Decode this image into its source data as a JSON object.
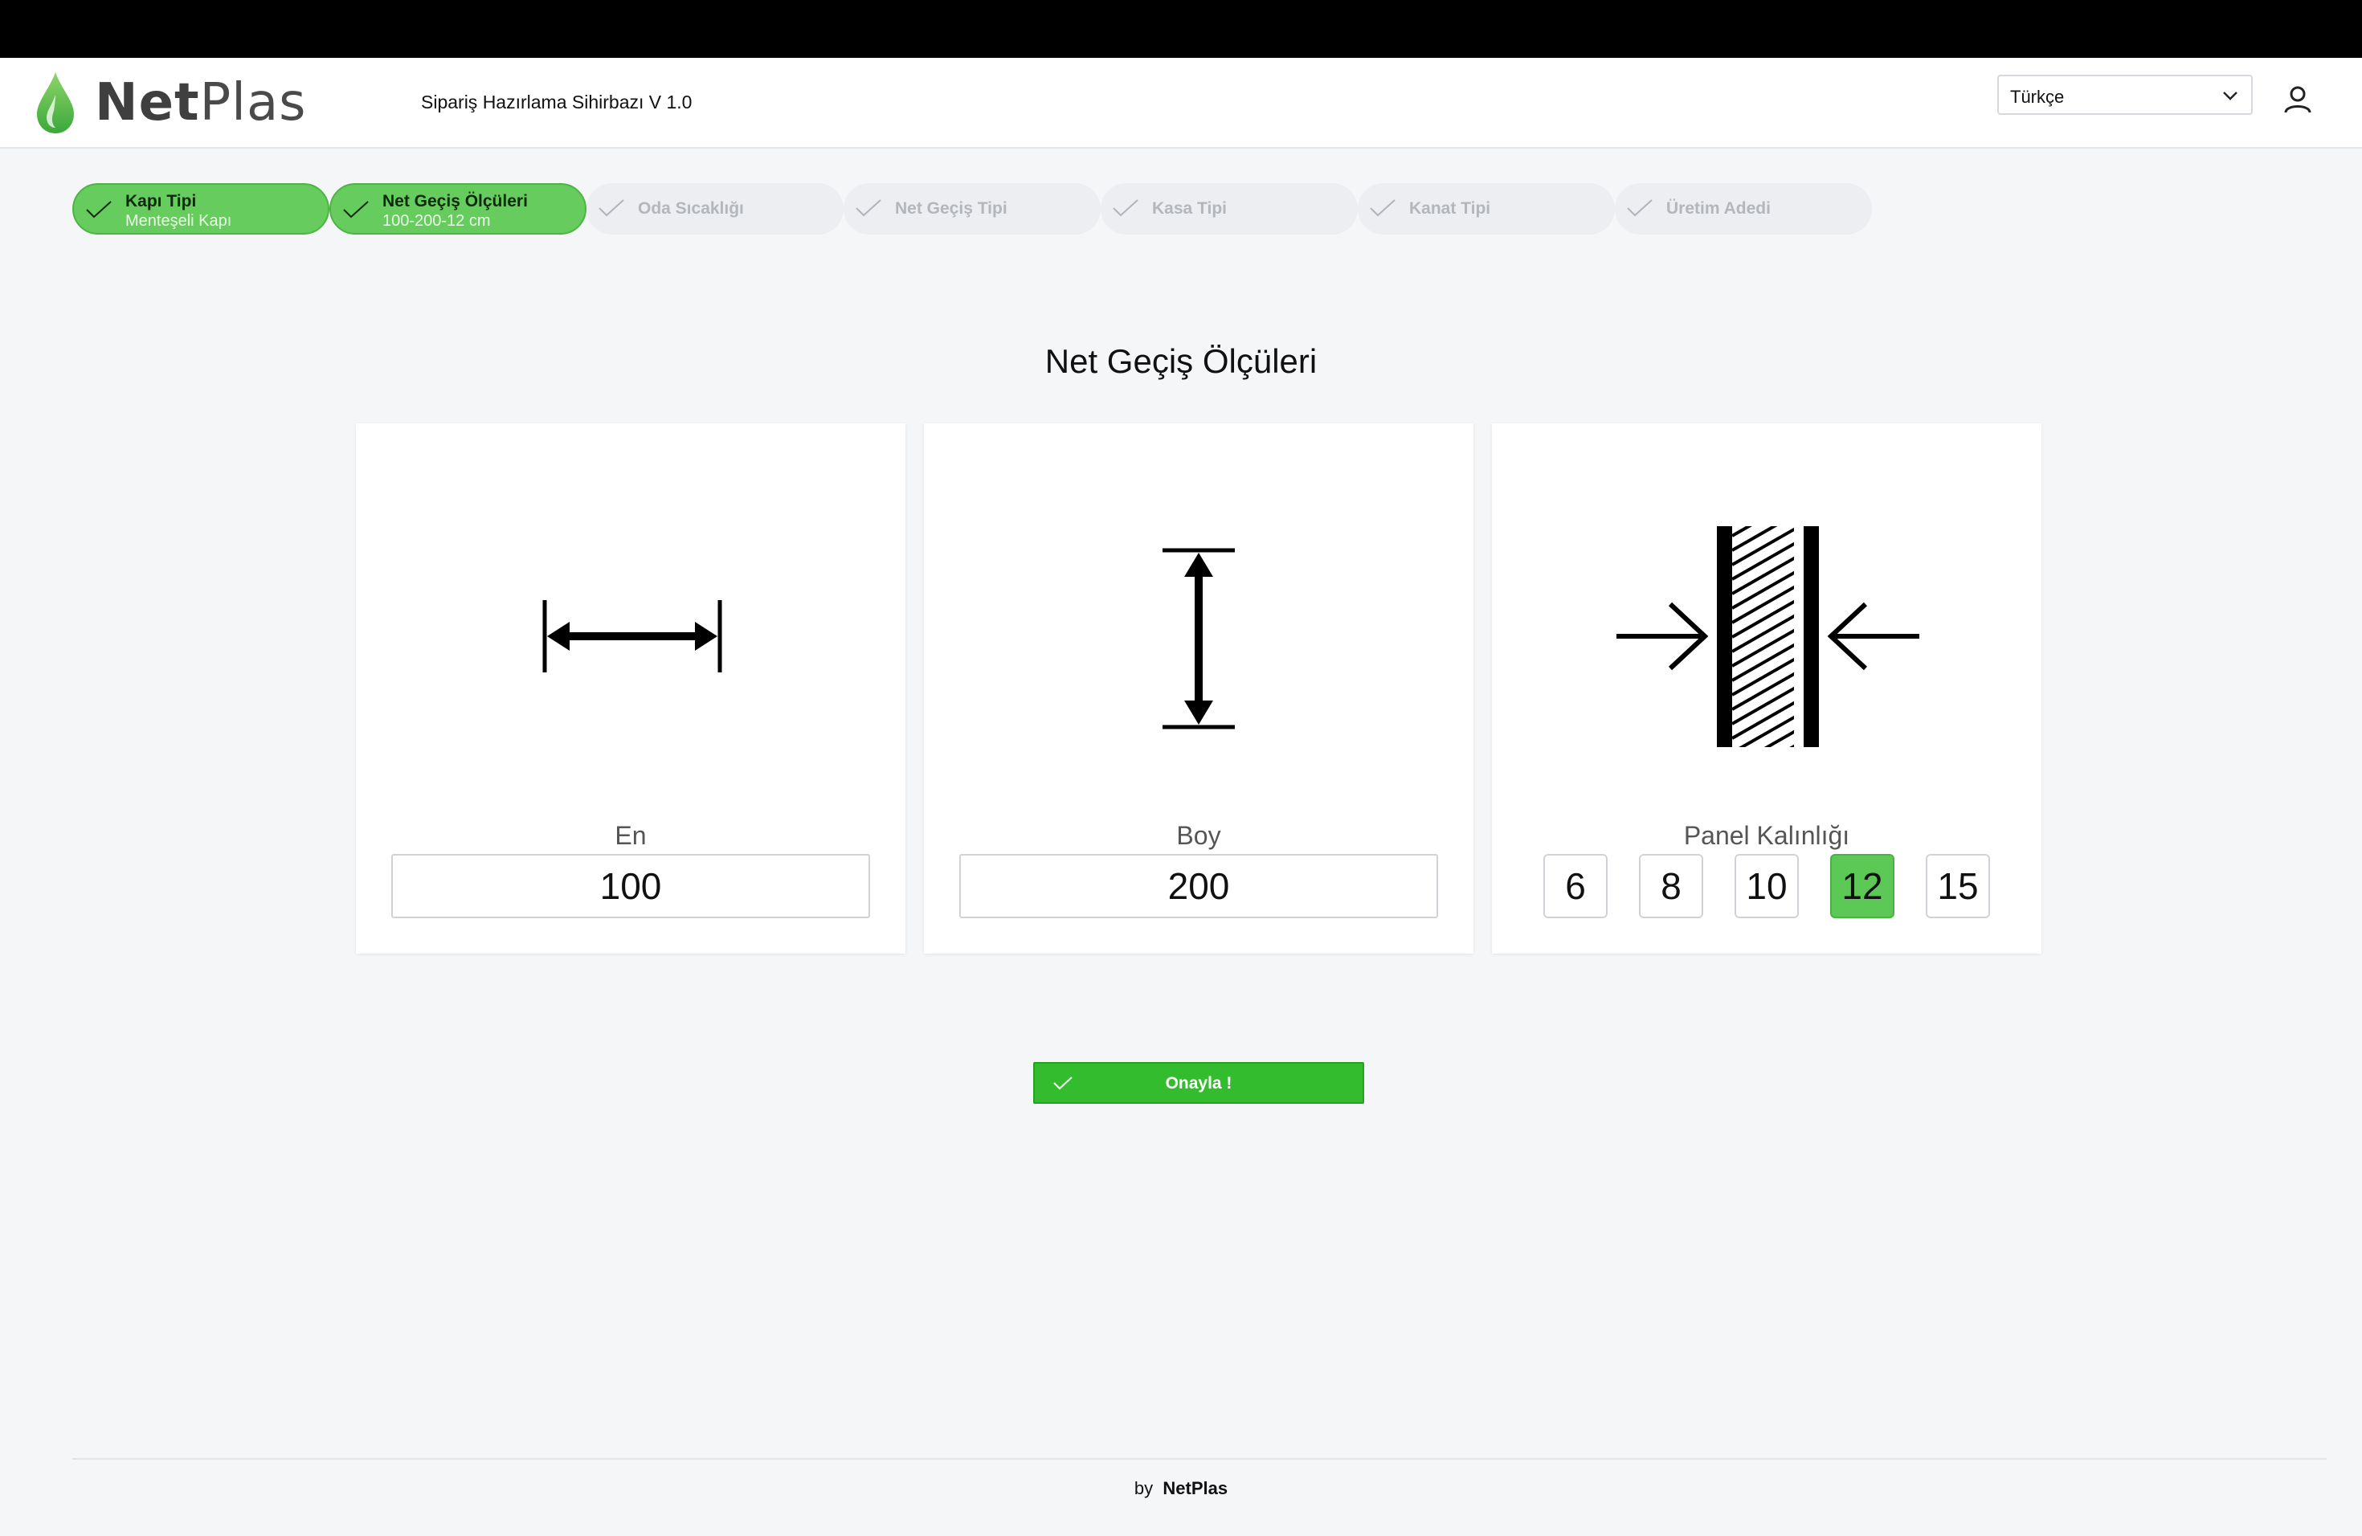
{
  "header": {
    "brand_bold": "Net",
    "brand_light": "Plas",
    "app_title": "Sipariş Hazırlama Sihirbazı V 1.0",
    "language": "Türkçe"
  },
  "steps": [
    {
      "label": "Kapı Tipi",
      "value": "Menteşeli Kapı",
      "status": "done"
    },
    {
      "label": "Net Geçiş Ölçüleri",
      "value": "100-200-12 cm",
      "status": "done"
    },
    {
      "label": "Oda Sıcaklığı",
      "value": "",
      "status": "pending"
    },
    {
      "label": "Net Geçiş Tipi",
      "value": "",
      "status": "pending"
    },
    {
      "label": "Kasa Tipi",
      "value": "",
      "status": "pending"
    },
    {
      "label": "Kanat Tipi",
      "value": "",
      "status": "pending"
    },
    {
      "label": "Üretim Adedi",
      "value": "",
      "status": "pending"
    }
  ],
  "main": {
    "heading": "Net Geçiş Ölçüleri",
    "width": {
      "label": "En",
      "value": "100"
    },
    "height": {
      "label": "Boy",
      "value": "200"
    },
    "panel": {
      "label": "Panel Kalınlığı",
      "options": [
        "6",
        "8",
        "10",
        "12",
        "15"
      ],
      "selected": "12"
    },
    "confirm_label": "Onayla !"
  },
  "footer": {
    "prefix": "by",
    "brand": "NetPlas"
  },
  "colors": {
    "accent": "#33bd2e",
    "step_done": "#66cc5d",
    "selected": "#5cc956"
  },
  "icons": [
    "drop-logo-icon",
    "chevron-down-icon",
    "user-icon",
    "check-icon",
    "horizontal-dimension-icon",
    "vertical-dimension-icon",
    "panel-thickness-icon"
  ]
}
